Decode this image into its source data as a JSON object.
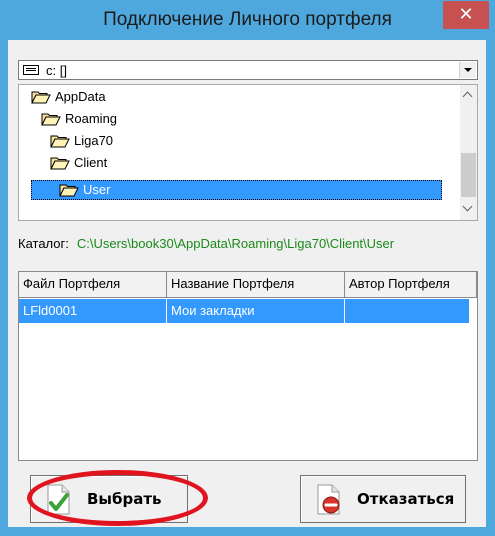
{
  "window": {
    "title": "Подключение Личного портфеля",
    "close_glyph": "✕"
  },
  "drive_select": {
    "value": "c: []",
    "icon": "drive-icon"
  },
  "tree": {
    "items": [
      {
        "label": "AppData"
      },
      {
        "label": "Roaming"
      },
      {
        "label": "Liga70"
      },
      {
        "label": "Client"
      },
      {
        "label": "User",
        "selected": true
      }
    ]
  },
  "catalog": {
    "label": "Каталог:",
    "path": "C:\\Users\\book30\\AppData\\Roaming\\Liga70\\Client\\User"
  },
  "table": {
    "columns": [
      "Файл Портфеля",
      "Название Портфеля",
      "Автор Портфеля"
    ],
    "rows": [
      {
        "file": "LFld0001",
        "name": "Мои закладки",
        "author": ""
      }
    ]
  },
  "buttons": {
    "ok_label": "Выбрать",
    "cancel_label": "Отказаться"
  },
  "colors": {
    "title_bar": "#4ea8dd",
    "selection": "#3399ff",
    "path_text": "#1a8a1a",
    "highlight": "#e0141e"
  }
}
